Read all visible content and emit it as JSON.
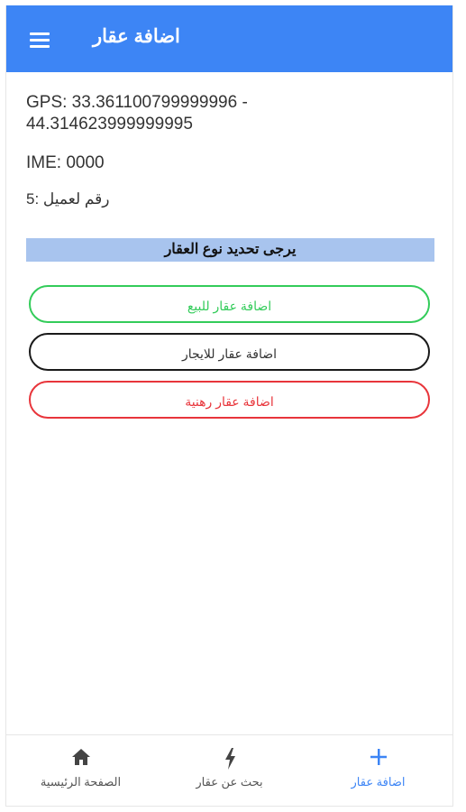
{
  "appbar": {
    "title": "اضافة عقار"
  },
  "info": {
    "gps_line1": "GPS: 33.361100799999996 -",
    "gps_line2": "44.314623999999995",
    "ime": "IME: 0000",
    "client_number": "رقم لعميل :5"
  },
  "section": {
    "prompt": "يرجى تحديد نوع العقار"
  },
  "buttons": {
    "sale": "اضافة عقار للبيع",
    "rent": "اضافة عقار للايجار",
    "mortgage": "اضافة عقار رهنية"
  },
  "bottom_nav": {
    "home": "الصفحة الرئيسية",
    "search": "بحث عن عقار",
    "add": "اضافة عقار"
  },
  "colors": {
    "primary": "#3d85f5",
    "sale": "#33cc5a",
    "rent": "#1a1a1a",
    "mortgage": "#e8353b",
    "section_bg": "#a8c4ee"
  },
  "icons": {
    "menu": "hamburger-menu-icon",
    "home": "home-icon",
    "search": "bolt-icon",
    "add": "plus-icon"
  }
}
